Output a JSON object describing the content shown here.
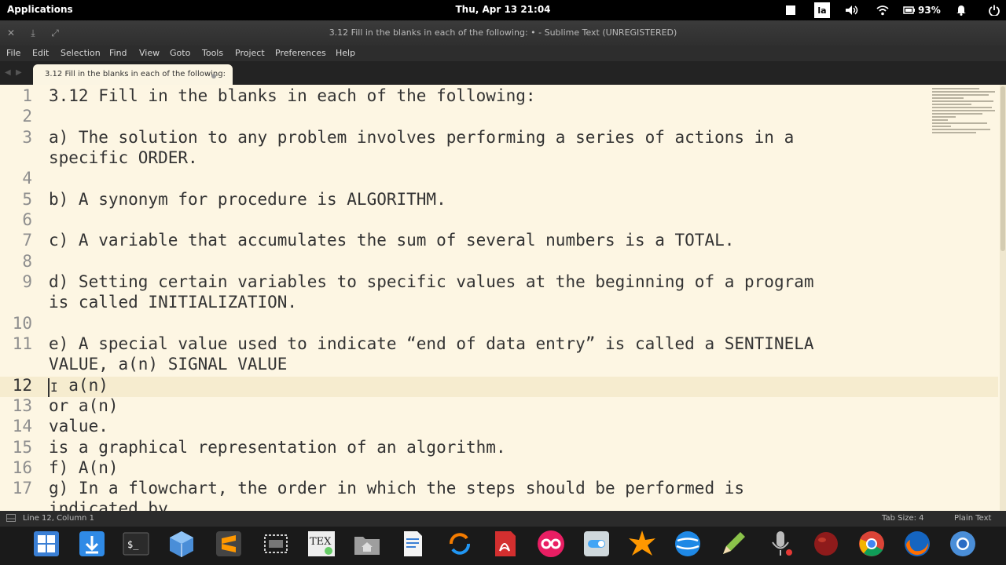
{
  "topbar": {
    "applications": "Applications",
    "clock": "Thu, Apr 13   21:04",
    "keyboard": "la",
    "battery": "93%"
  },
  "window": {
    "title": "3.12 Fill in the blanks in each of the following: • - Sublime Text (UNREGISTERED)"
  },
  "menu": [
    "File",
    "Edit",
    "Selection",
    "Find",
    "View",
    "Goto",
    "Tools",
    "Project",
    "Preferences",
    "Help"
  ],
  "tab": {
    "label": "3.12 Fill in the blanks in each of the following:"
  },
  "editor": {
    "gutter": [
      "1",
      "2",
      "3",
      "",
      "4",
      "5",
      "6",
      "7",
      "8",
      "9",
      "",
      "10",
      "11",
      "",
      "12",
      "13",
      "14",
      "15",
      "16",
      "17"
    ],
    "lines": [
      "3.12 Fill in the blanks in each of the following:",
      "",
      "a) The solution to any problem involves performing a series of actions in a",
      "specific ORDER.",
      "",
      "b) A synonym for procedure is ALGORITHM.",
      "",
      "c) A variable that accumulates the sum of several numbers is a TOTAL.",
      "",
      "d) Setting certain variables to specific values at the beginning of a program",
      "is called INITIALIZATION.",
      "",
      "e) A special value used to indicate “end of data entry” is called a SENTINELA",
      "VALUE, a(n) SIGNAL VALUE",
      "  a(n)",
      "or a(n)",
      "value.",
      "is a graphical representation of an algorithm.",
      "f) A(n)",
      "g) In a flowchart, the order in which the steps should be performed is",
      "indicated by"
    ]
  },
  "status": {
    "position": "Line 12, Column 1",
    "tab_size": "Tab Size: 4",
    "syntax": "Plain Text"
  },
  "dock": {
    "tex_label": "TEX"
  }
}
